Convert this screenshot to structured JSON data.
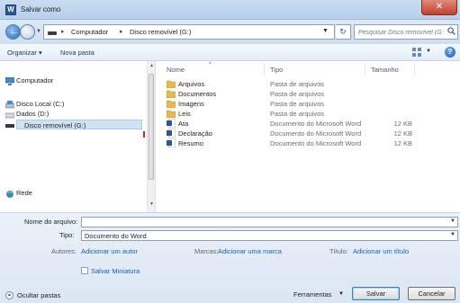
{
  "window": {
    "title": "Salvar como",
    "app_icon_letter": "W"
  },
  "address": {
    "crumbs": [
      "Computador",
      "Disco removível (G:)"
    ],
    "search_placeholder": "Pesquisar Disco removível (G:)"
  },
  "toolbar": {
    "organize_label": "Organizar ▾",
    "new_folder_label": "Nova pasta"
  },
  "nav": {
    "items": [
      {
        "label": "Computador",
        "icon": "computer-icon"
      },
      {
        "label": "Disco Local (C:)",
        "icon": "drive-icon"
      },
      {
        "label": "Dados (D:)",
        "icon": "drive-icon"
      },
      {
        "label": "Disco removível (G:)",
        "icon": "removable-drive-icon"
      },
      {
        "label": "Rede",
        "icon": "network-icon"
      }
    ]
  },
  "files": {
    "columns": {
      "name": "Nome",
      "type": "Tipo",
      "size": "Tamanho"
    },
    "rows": [
      {
        "name": "Arquivos",
        "type": "Pasta de arquivos",
        "size": "",
        "icon": "folder-icon"
      },
      {
        "name": "Documentos",
        "type": "Pasta de arquivos",
        "size": "",
        "icon": "folder-icon"
      },
      {
        "name": "Imagens",
        "type": "Pasta de arquivos",
        "size": "",
        "icon": "folder-icon"
      },
      {
        "name": "Leis",
        "type": "Pasta de arquivos",
        "size": "",
        "icon": "folder-icon"
      },
      {
        "name": "Ata",
        "type": "Documento do Microsoft Word",
        "size": "12 KB",
        "icon": "word-doc-icon"
      },
      {
        "name": "Declaração",
        "type": "Documento do Microsoft Word",
        "size": "12 KB",
        "icon": "word-doc-icon"
      },
      {
        "name": "Resumo",
        "type": "Documento do Microsoft Word",
        "size": "12 KB",
        "icon": "word-doc-icon"
      }
    ]
  },
  "form": {
    "filename_label": "Nome do arquivo:",
    "filename_value": "",
    "type_label": "Tipo:",
    "type_value": "Documento do Word",
    "authors_label": "Autores:",
    "authors_link": "Adicionar um autor",
    "tags_label": "Marcas:",
    "tags_link": "Adicionar uma marca",
    "title_label": "Título:",
    "title_link": "Adicionar um título",
    "thumbnail_label": "Salvar Miniatura",
    "hide_folders_label": "Ocultar pastas",
    "tools_label": "Ferramentas",
    "save_label": "Salvar",
    "cancel_label": "Cancelar"
  },
  "colors": {
    "accent": "#1c5fb0",
    "titlebar": "#c9dcf2",
    "close": "#c4402d"
  }
}
